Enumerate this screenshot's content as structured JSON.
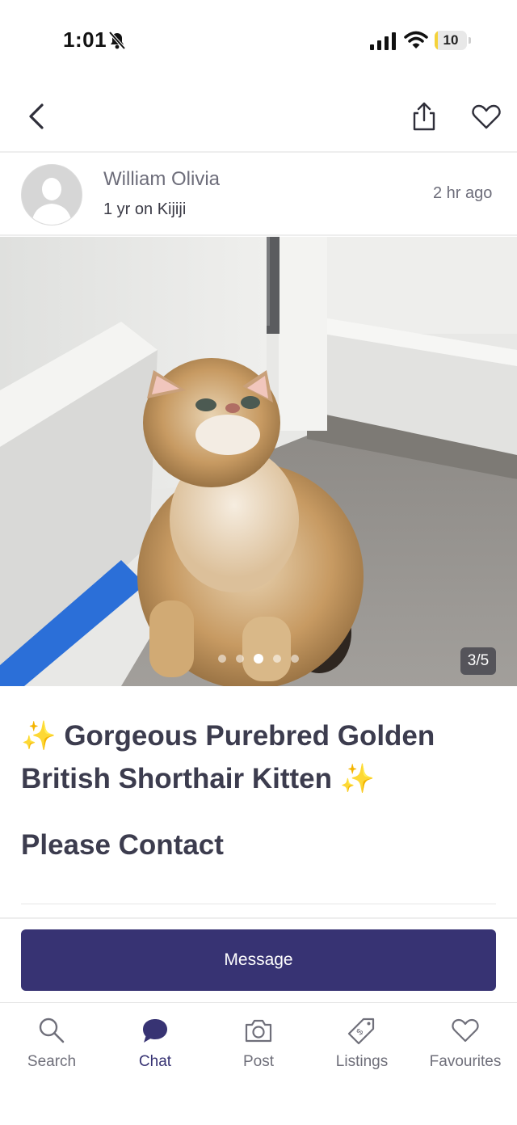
{
  "status_bar": {
    "time": "1:01",
    "battery": "10",
    "battery_level": 0.1
  },
  "listing_nav": {
    "back_icon": "chevron-left-icon",
    "share_icon": "share-icon",
    "favourite_icon": "heart-icon"
  },
  "seller": {
    "name": "William Olivia",
    "tenure": "1 yr on Kijiji",
    "posted": "2 hr  ago"
  },
  "gallery": {
    "counter": "3/5",
    "current_index": 3,
    "total": 5
  },
  "listing": {
    "sparkle_left": "✨",
    "title": "Gorgeous Purebred Golden British Shorthair Kitten",
    "sparkle_right": "✨",
    "price_text": "Please Contact"
  },
  "actions": {
    "message_label": "Message"
  },
  "colors": {
    "brand": "#373373",
    "sparkle": "#f2c53d"
  },
  "tabs": [
    {
      "label": "Search",
      "icon": "search-icon"
    },
    {
      "label": "Chat",
      "icon": "chat-bubble-icon"
    },
    {
      "label": "Post",
      "icon": "camera-icon"
    },
    {
      "label": "Listings",
      "icon": "price-tag-icon"
    },
    {
      "label": "Favourites",
      "icon": "heart-icon"
    }
  ],
  "active_tab": "Chat"
}
